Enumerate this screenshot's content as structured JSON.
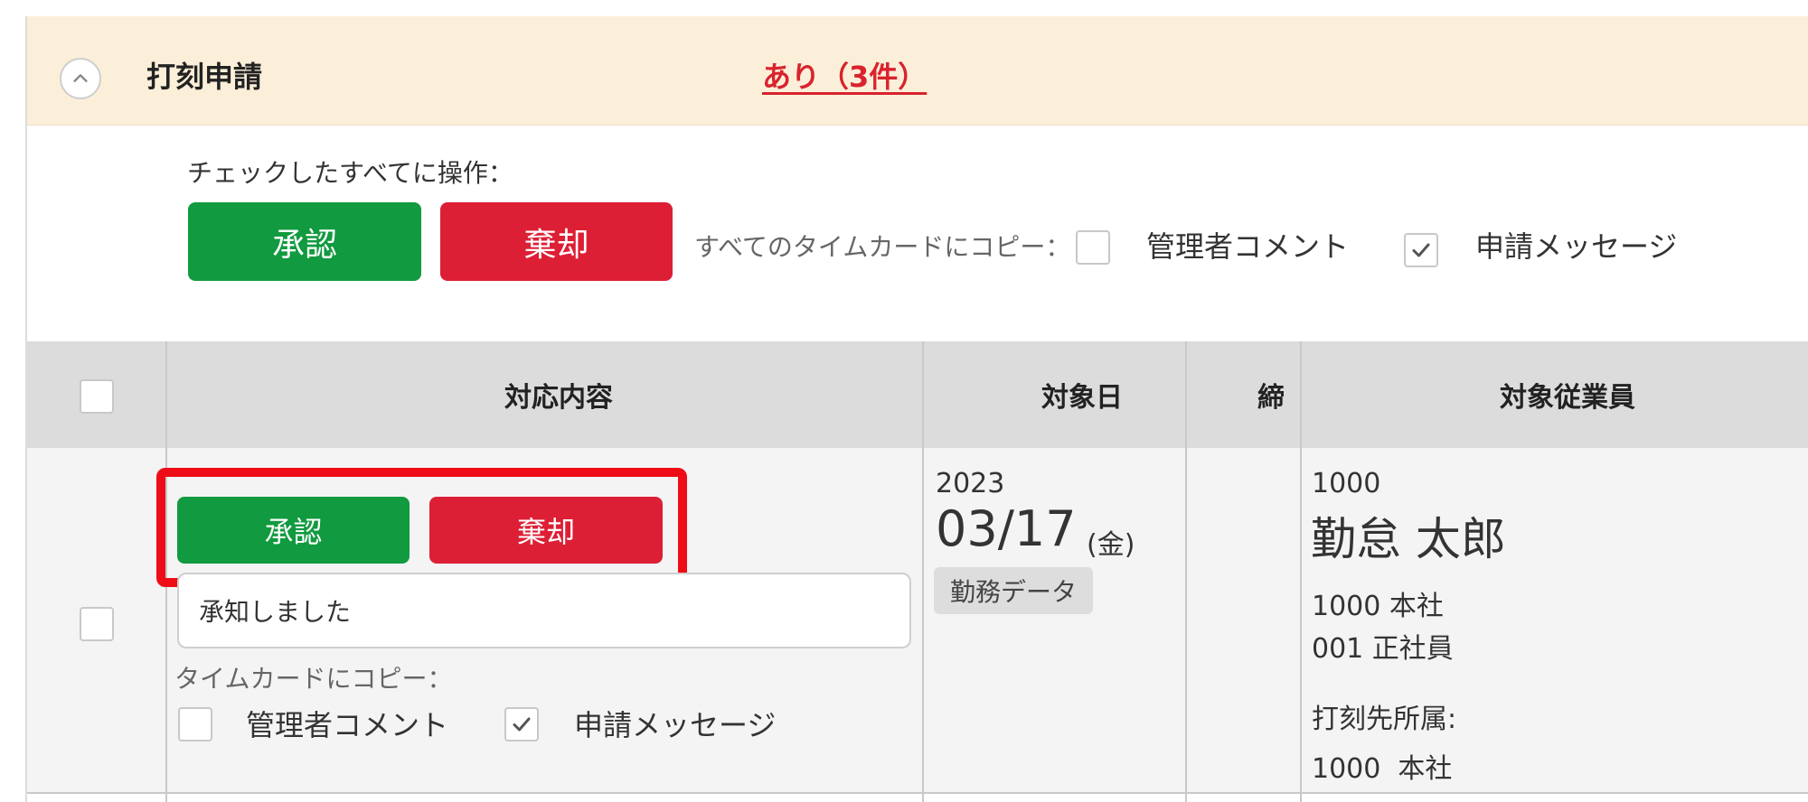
{
  "section": {
    "title": "打刻申請",
    "status": "あり（3件）"
  },
  "bulk": {
    "label": "チェックしたすべてに操作：",
    "approve": "承認",
    "reject": "棄却",
    "copy_label": "すべてのタイムカードにコピー：",
    "admin_comment": "管理者コメント",
    "admin_comment_checked": false,
    "request_message": "申請メッセージ",
    "request_message_checked": true
  },
  "table": {
    "headers": [
      "対応内容",
      "対象日",
      "締",
      "対象従業員"
    ]
  },
  "row": {
    "approve": "承認",
    "reject": "棄却",
    "comment": "承知しました",
    "copy_label": "タイムカードにコピー：",
    "admin_comment": "管理者コメント",
    "admin_comment_checked": false,
    "request_message": "申請メッセージ",
    "request_message_checked": true,
    "date": {
      "year": "2023",
      "month_day": "03/17",
      "weekday": "(金)",
      "tag": "勤務データ"
    },
    "employee": {
      "code": "1000",
      "name": "勤怠 太郎",
      "department": "1000 本社",
      "employment_type": "001 正社員",
      "punch_label": "打刻先所属:",
      "punch_value": "1000  本社"
    }
  },
  "colors": {
    "approve": "#119a3f",
    "reject": "#dd1f35",
    "header_bg": "#fcefd9",
    "status_text": "#d9232e",
    "highlight": "#ee0d16"
  },
  "icons": {
    "collapse": "chevron-up-icon",
    "check": "checkmark-icon"
  }
}
